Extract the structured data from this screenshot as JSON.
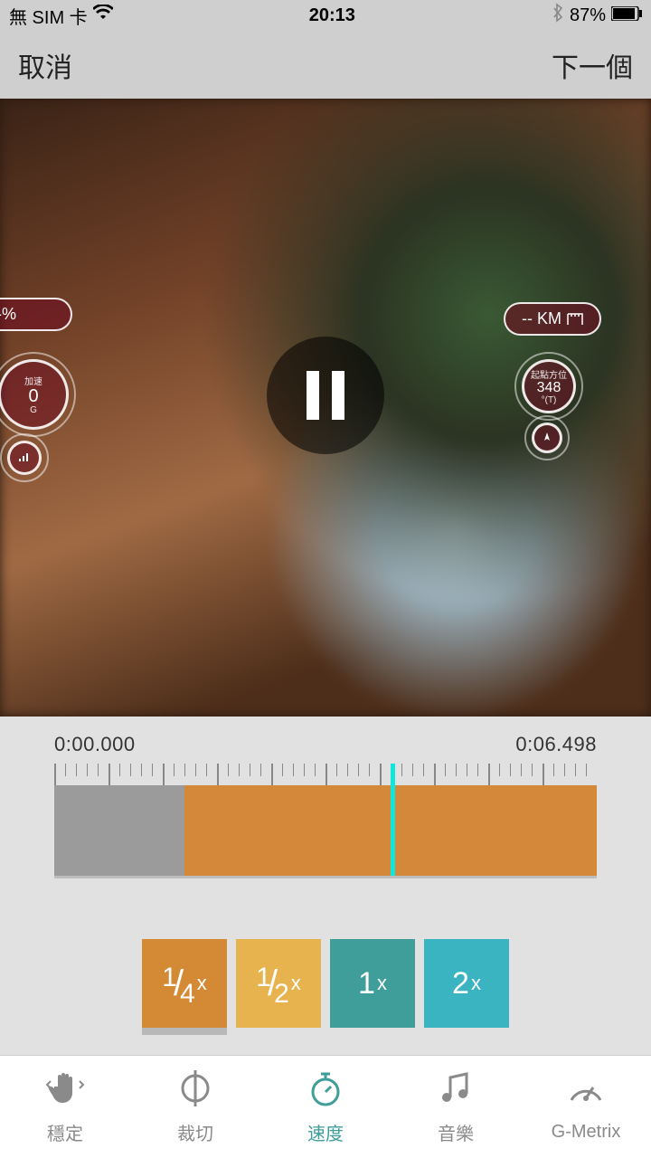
{
  "status": {
    "carrier": "無 SIM 卡",
    "time": "20:13",
    "battery_pct": "87%"
  },
  "nav": {
    "cancel": "取消",
    "next": "下一個"
  },
  "video": {
    "playing": true
  },
  "overlay": {
    "left_pill": "--%",
    "left_gauge": {
      "label": "加速",
      "value": "0",
      "unit": "G"
    },
    "right_pill": "-- KM",
    "right_gauge": {
      "label": "起點方位",
      "value": "348",
      "unit": "°(T)"
    }
  },
  "timeline": {
    "start": "0:00.000",
    "end": "0:06.498",
    "playhead_ratio": 0.62,
    "gray_ratio": 0.24
  },
  "speeds": {
    "quarter": "¼",
    "half": "½",
    "one": "1",
    "two": "2",
    "x": "x",
    "selected": "quarter"
  },
  "tabs": {
    "t1": "穩定",
    "t2": "裁切",
    "t3": "速度",
    "t4": "音樂",
    "t5": "G-Metrix",
    "selected": "t3"
  }
}
